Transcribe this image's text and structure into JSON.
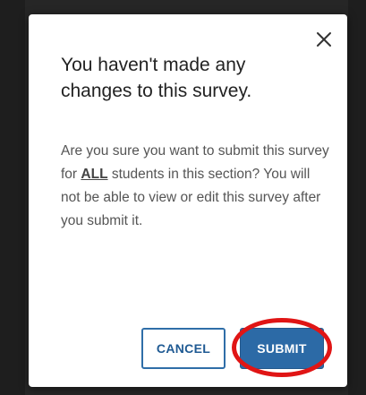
{
  "dialog": {
    "title": "You haven't made any changes to this survey.",
    "body": {
      "part1": "Are you sure you want to submit this survey for ",
      "emphasis": "ALL",
      "part2": " students in this section? You will not be able to view or edit this survey after you submit it."
    },
    "close_icon": "close-icon",
    "cancel_label": "CANCEL",
    "submit_label": "SUBMIT"
  },
  "colors": {
    "primary": "#2c6aa6",
    "highlight": "#e01515"
  }
}
